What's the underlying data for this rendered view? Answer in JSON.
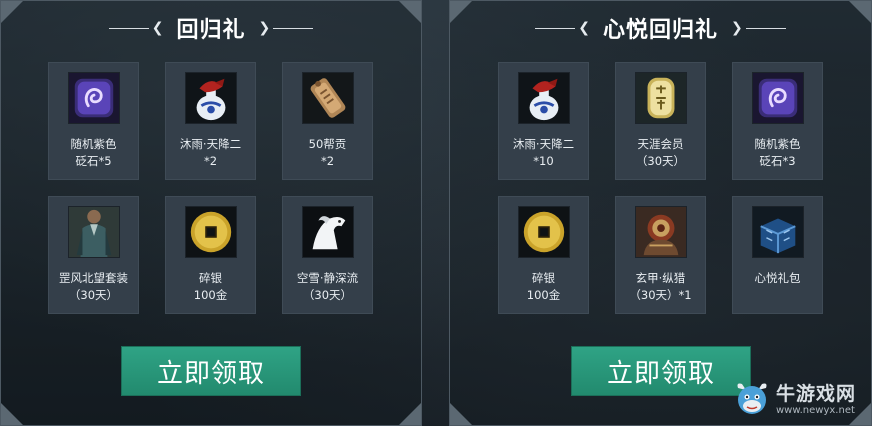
{
  "left_panel": {
    "title": "回归礼",
    "items": [
      {
        "line1": "随机紫色",
        "line2": "砭石*5",
        "icon": "purple-stone-icon"
      },
      {
        "line1": "沐雨·天降二",
        "line2": "*2",
        "icon": "wine-jar-icon"
      },
      {
        "line1": "50帮贡",
        "line2": "*2",
        "icon": "token-plate-icon"
      },
      {
        "line1": "罡风北望套装",
        "line2": "（30天）",
        "icon": "outfit-icon"
      },
      {
        "line1": "碎银",
        "line2": "100金",
        "icon": "gold-coin-icon"
      },
      {
        "line1": "空雪·静深流",
        "line2": "（30天）",
        "icon": "white-horse-icon"
      }
    ],
    "button_label": "立即领取"
  },
  "right_panel": {
    "title": "心悦回归礼",
    "items": [
      {
        "line1": "沐雨·天降二",
        "line2": "*10",
        "icon": "wine-jar-icon"
      },
      {
        "line1": "天涯会员",
        "line2": "（30天）",
        "icon": "vip-tablet-icon"
      },
      {
        "line1": "随机紫色",
        "line2": "砭石*3",
        "icon": "purple-stone-icon"
      },
      {
        "line1": "碎银",
        "line2": "100金",
        "icon": "gold-coin-icon"
      },
      {
        "line1": "玄甲·纵猎",
        "line2": "（30天）*1",
        "icon": "armor-icon"
      },
      {
        "line1": "心悦礼包",
        "line2": "",
        "icon": "gift-box-icon"
      }
    ],
    "button_label": "立即领取"
  },
  "watermark": {
    "name": "牛游戏网",
    "url": "www.newyx.net"
  },
  "colors": {
    "button": "#2a9a7c",
    "tile": "#343f4a",
    "background": "#1b232a"
  }
}
